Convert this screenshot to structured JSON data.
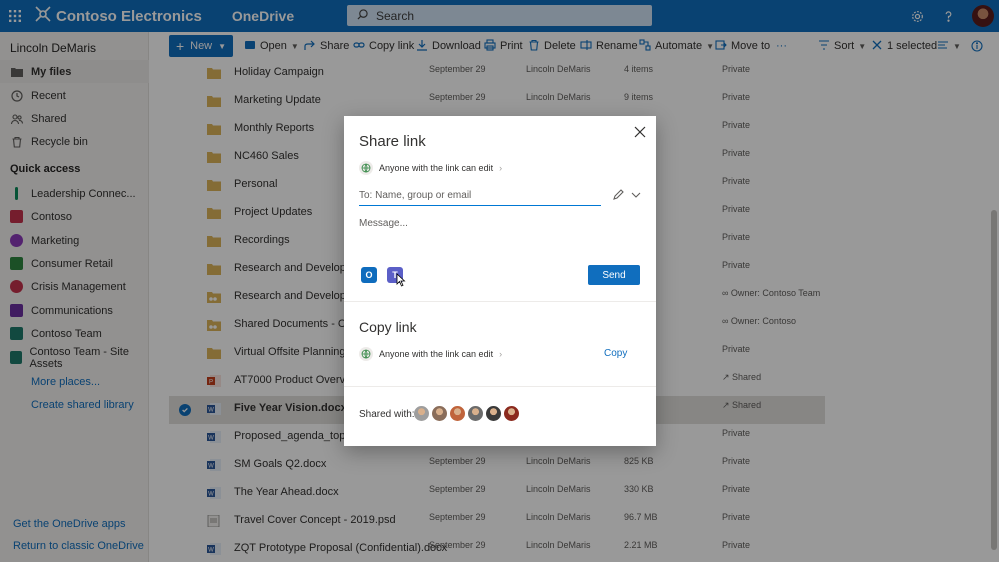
{
  "topbar": {
    "brand": "Contoso Electronics",
    "app": "OneDrive",
    "search_placeholder": "Search",
    "icons": [
      "waffle-icon",
      "search-icon",
      "gear-icon",
      "help-icon",
      "avatar"
    ]
  },
  "leftnav": {
    "user": "Lincoln DeMaris",
    "items": [
      {
        "label": "My files",
        "icon": "folder-icon",
        "active": true
      },
      {
        "label": "Recent",
        "icon": "clock-icon"
      },
      {
        "label": "Shared",
        "icon": "people-icon"
      },
      {
        "label": "Recycle bin",
        "icon": "trash-icon"
      }
    ],
    "quick_access_label": "Quick access",
    "quick_access": [
      {
        "label": "Leadership Connec...",
        "color": "#0b8b5a"
      },
      {
        "label": "Contoso",
        "color": "#c4314b"
      },
      {
        "label": "Marketing",
        "color": "#8a3ab9"
      },
      {
        "label": "Consumer Retail",
        "color": "#2e8540"
      },
      {
        "label": "Crisis Management",
        "color": "#c4314b"
      },
      {
        "label": "Communications",
        "color": "#6b2fa0"
      },
      {
        "label": "Contoso Team",
        "color": "#1f7a6b"
      },
      {
        "label": "Contoso Team - Site Assets",
        "color": "#1f7a6b"
      }
    ],
    "more_places": "More places...",
    "create_library": "Create shared library",
    "get_apps": "Get the OneDrive apps",
    "return_classic": "Return to classic OneDrive"
  },
  "cmdbar": {
    "new": "New",
    "open": "Open",
    "share": "Share",
    "copy_link": "Copy link",
    "download": "Download",
    "print": "Print",
    "delete": "Delete",
    "rename": "Rename",
    "automate": "Automate",
    "move_to": "Move to",
    "more": "···",
    "sort": "Sort",
    "selected": "1 selected"
  },
  "files": [
    {
      "name": "Holiday Campaign",
      "type": "folder",
      "date": "September 29",
      "modified_by": "Lincoln DeMaris",
      "size": "4 items",
      "sharing": "Private"
    },
    {
      "name": "Marketing Update",
      "type": "folder",
      "date": "September 29",
      "modified_by": "Lincoln DeMaris",
      "size": "9 items",
      "sharing": "Private"
    },
    {
      "name": "Monthly Reports",
      "type": "folder",
      "date": "",
      "modified_by": "",
      "size": "",
      "sharing": "Private"
    },
    {
      "name": "NC460 Sales",
      "type": "folder",
      "date": "",
      "modified_by": "",
      "size": "",
      "sharing": "Private"
    },
    {
      "name": "Personal",
      "type": "folder",
      "date": "",
      "modified_by": "",
      "size": "",
      "sharing": "Private"
    },
    {
      "name": "Project Updates",
      "type": "folder",
      "date": "",
      "modified_by": "",
      "size": "",
      "sharing": "Private"
    },
    {
      "name": "Recordings",
      "type": "folder",
      "date": "",
      "modified_by": "",
      "size": "",
      "sharing": "Private"
    },
    {
      "name": "Research and Development",
      "type": "folder",
      "date": "",
      "modified_by": "",
      "size": "",
      "sharing": "Private"
    },
    {
      "name": "Research and Development",
      "type": "shared-folder",
      "date": "",
      "modified_by": "",
      "size": "",
      "sharing": "Owner: Contoso Team"
    },
    {
      "name": "Shared Documents - Conto",
      "type": "shared-folder",
      "date": "",
      "modified_by": "",
      "size": "",
      "sharing": "Owner: Contoso"
    },
    {
      "name": "Virtual Offsite Planning",
      "type": "folder",
      "date": "",
      "modified_by": "",
      "size": "",
      "sharing": "Private"
    },
    {
      "name": "AT7000 Product Overview.p",
      "type": "ppt",
      "date": "",
      "modified_by": "",
      "size": "",
      "sharing": "Shared"
    },
    {
      "name": "Five Year Vision.docx",
      "type": "word",
      "date": "",
      "modified_by": "",
      "size": "",
      "sharing": "Shared",
      "selected": true
    },
    {
      "name": "Proposed_agenda_topics.do",
      "type": "word",
      "date": "",
      "modified_by": "",
      "size": "",
      "sharing": "Private"
    },
    {
      "name": "SM Goals Q2.docx",
      "type": "word",
      "date": "September 29",
      "modified_by": "Lincoln DeMaris",
      "size": "825 KB",
      "sharing": "Private"
    },
    {
      "name": "The Year Ahead.docx",
      "type": "word",
      "date": "September 29",
      "modified_by": "Lincoln DeMaris",
      "size": "330 KB",
      "sharing": "Private"
    },
    {
      "name": "Travel Cover Concept - 2019.psd",
      "type": "image",
      "date": "September 29",
      "modified_by": "Lincoln DeMaris",
      "size": "96.7 MB",
      "sharing": "Private"
    },
    {
      "name": "ZQT Prototype Proposal (Confidential).docx",
      "type": "word",
      "date": "September 29",
      "modified_by": "Lincoln DeMaris",
      "size": "2.21 MB",
      "sharing": "Private"
    }
  ],
  "dialog": {
    "title": "Share link",
    "permission": "Anyone with the link can edit",
    "to_placeholder": "To: Name, group or email",
    "message_placeholder": "Message...",
    "send": "Send",
    "copy_title": "Copy link",
    "copy_permission": "Anyone with the link can edit",
    "copy_button": "Copy",
    "shared_with": "Shared with:",
    "avatars": [
      "#9e9e9e",
      "#8a6d5a",
      "#c0643b",
      "#6b6b6b",
      "#3a3a3a",
      "#8b2a1e"
    ],
    "accent": "#106ebe"
  }
}
